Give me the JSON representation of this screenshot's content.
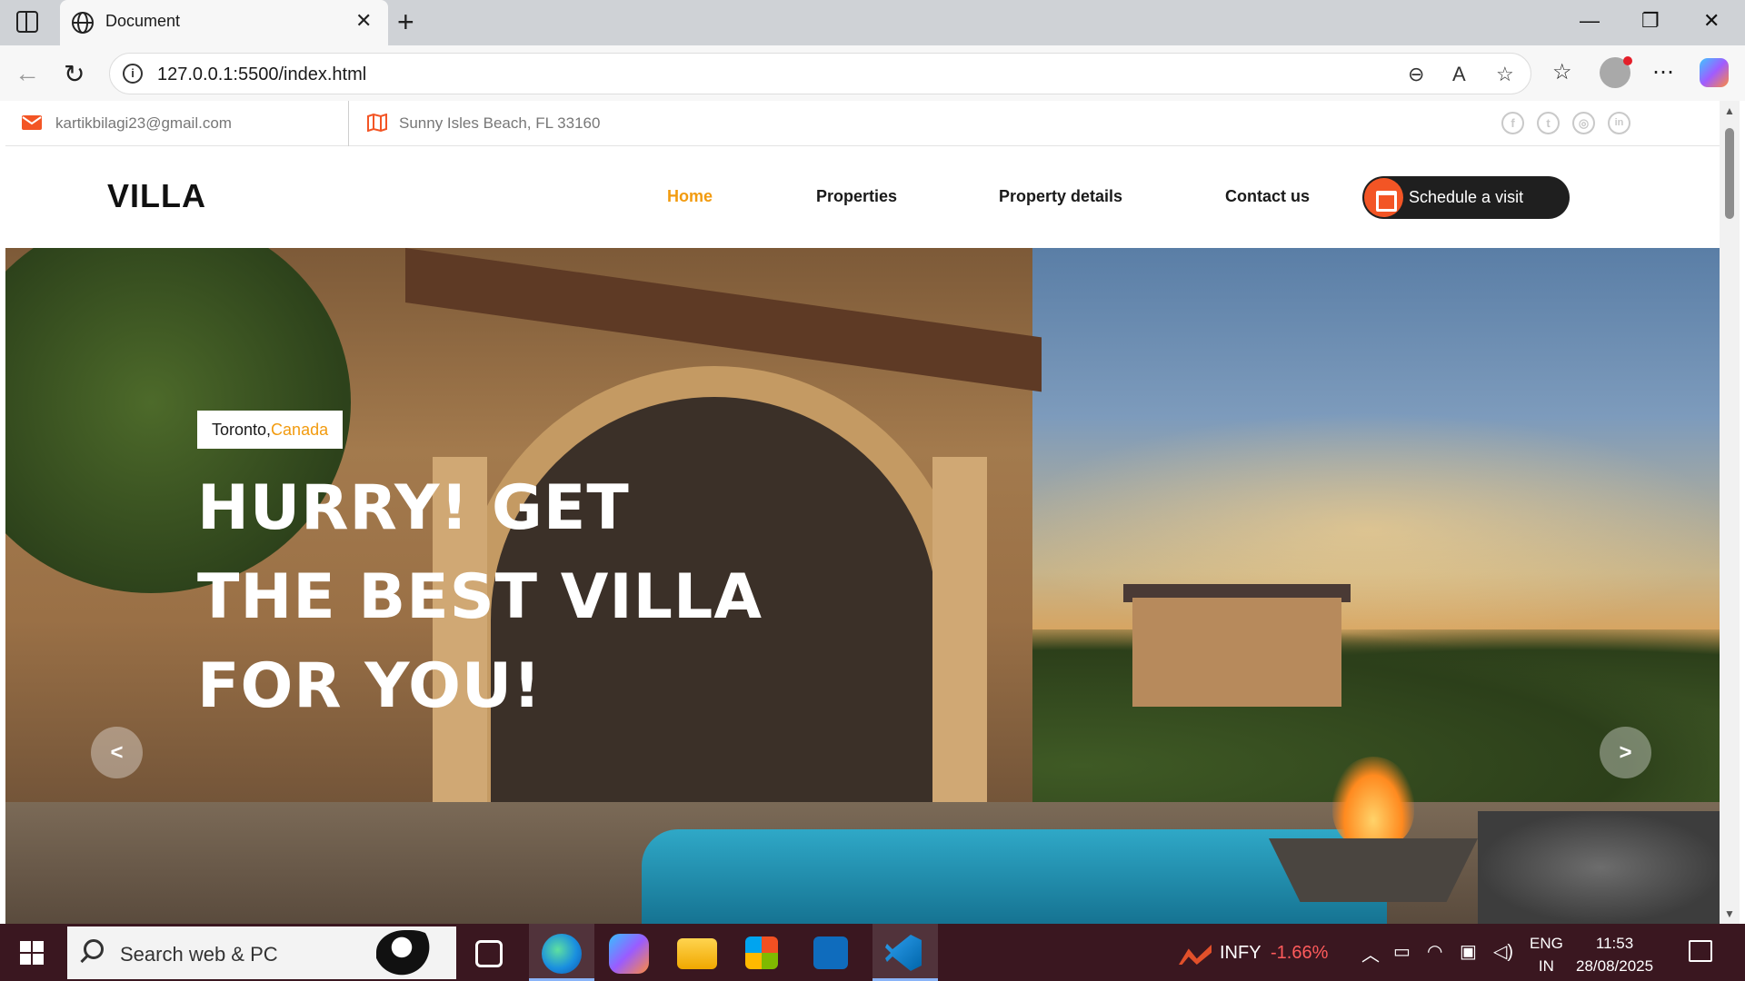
{
  "browser": {
    "tab_title": "Document",
    "url": "127.0.0.1:5500/index.html",
    "new_tab_icon": "plus-icon",
    "close_tab_icon": "close-icon"
  },
  "topbar": {
    "email": "kartikbilagi23@gmail.com",
    "address": "Sunny Isles Beach, FL 33160",
    "social": [
      {
        "icon": "facebook-icon",
        "glyph": "f"
      },
      {
        "icon": "twitter-icon",
        "glyph": "t"
      },
      {
        "icon": "instagram-icon",
        "glyph": "◎"
      },
      {
        "icon": "linkedin-icon",
        "glyph": "in"
      }
    ],
    "accent": "#f35525"
  },
  "header": {
    "logo": "VILLA",
    "nav": [
      "Home",
      "Properties",
      "Property details",
      "Contact us"
    ],
    "active_nav": "Home",
    "cta": "Schedule a visit",
    "active_color": "#f29b0f"
  },
  "hero": {
    "city": "Toronto,",
    "country": "Canada",
    "title_lines": [
      "HURRY! GET",
      "THE BEST VILLA",
      "FOR YOU!"
    ],
    "prev": "<",
    "next": ">"
  },
  "taskbar": {
    "search_placeholder": "Search web & PC",
    "stock_name": "INFY",
    "stock_change": "-1.66%",
    "lang_top": "ENG",
    "lang_bottom": "IN",
    "time": "11:53",
    "date": "28/08/2025"
  }
}
